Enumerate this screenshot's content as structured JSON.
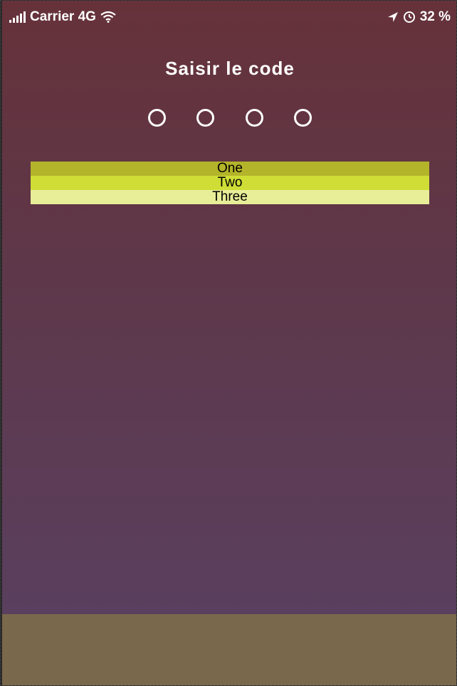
{
  "status_bar": {
    "carrier": "Carrier 4G",
    "battery": "32 %",
    "icons": [
      "signal-icon",
      "wifi-icon",
      "location-arrow-icon",
      "alarm-clock-icon"
    ]
  },
  "screen": {
    "title": "Saisir le code",
    "code_length": 4
  },
  "list": {
    "items": [
      {
        "label": "One",
        "color": "#b4b42a"
      },
      {
        "label": "Two",
        "color": "#cfdd36"
      },
      {
        "label": "Three",
        "color": "#e8ee98"
      }
    ]
  },
  "colors": {
    "background_top": "#66323a",
    "background_bottom": "#5a3f5e",
    "bottom_bar": "#7a684c",
    "text": "#ffffff"
  }
}
